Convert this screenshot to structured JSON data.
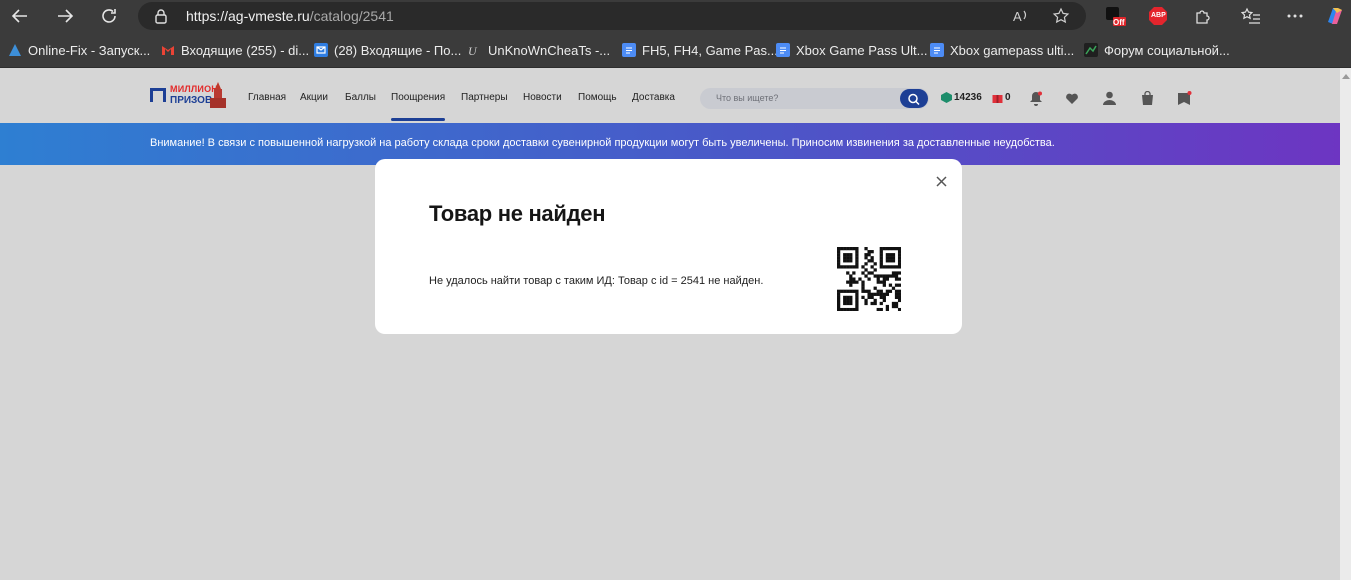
{
  "browser": {
    "url_host": "https://ag-vmeste.ru",
    "url_path": "/catalog/2541",
    "extensions": {
      "off_badge": "Off",
      "adblock_label": "ABP"
    }
  },
  "bookmarks": [
    {
      "label": "Online-Fix - Запуск...",
      "icon": "online-fix-icon",
      "color": "#3d8fd9"
    },
    {
      "label": "Входящие (255) - di...",
      "icon": "gmail-icon",
      "color": "#ea4335"
    },
    {
      "label": "(28) Входящие - По...",
      "icon": "mail-icon",
      "color": "#2f7de1"
    },
    {
      "label": "UnKnoWnCheaTs -...",
      "icon": "uc-icon",
      "color": "#cfcfcf"
    },
    {
      "label": "FH5, FH4, Game Pas...",
      "icon": "docs-icon",
      "color": "#4d8cf5"
    },
    {
      "label": "Xbox Game Pass Ult...",
      "icon": "docs-icon",
      "color": "#4d8cf5"
    },
    {
      "label": "Xbox gamepass ulti...",
      "icon": "docs-icon",
      "color": "#4d8cf5"
    },
    {
      "label": "Форум социальной...",
      "icon": "forum-icon",
      "color": "#3aa55a"
    }
  ],
  "site": {
    "logo_line1": "МИЛЛИОН",
    "logo_line2": "ПРИЗОВ",
    "menu": [
      {
        "label": "Главная"
      },
      {
        "label": "Акции"
      },
      {
        "label": "Баллы"
      },
      {
        "label": "Поощрения",
        "active": true
      },
      {
        "label": "Партнеры"
      },
      {
        "label": "Новости"
      },
      {
        "label": "Помощь"
      },
      {
        "label": "Доставка"
      }
    ],
    "search_placeholder": "Что вы ищете?",
    "points": "14236",
    "gifts": "0",
    "accent_color": "#1d3f95"
  },
  "banner": {
    "text": "Внимание! В связи с повышенной нагрузкой на работу склада сроки доставки сувенирной продукции могут быть увеличены. Приносим извинения за доставленные неудобства."
  },
  "modal": {
    "title": "Товар не найден",
    "message": "Не удалось найти товар с таким ИД: Товар с id = 2541 не найден."
  }
}
